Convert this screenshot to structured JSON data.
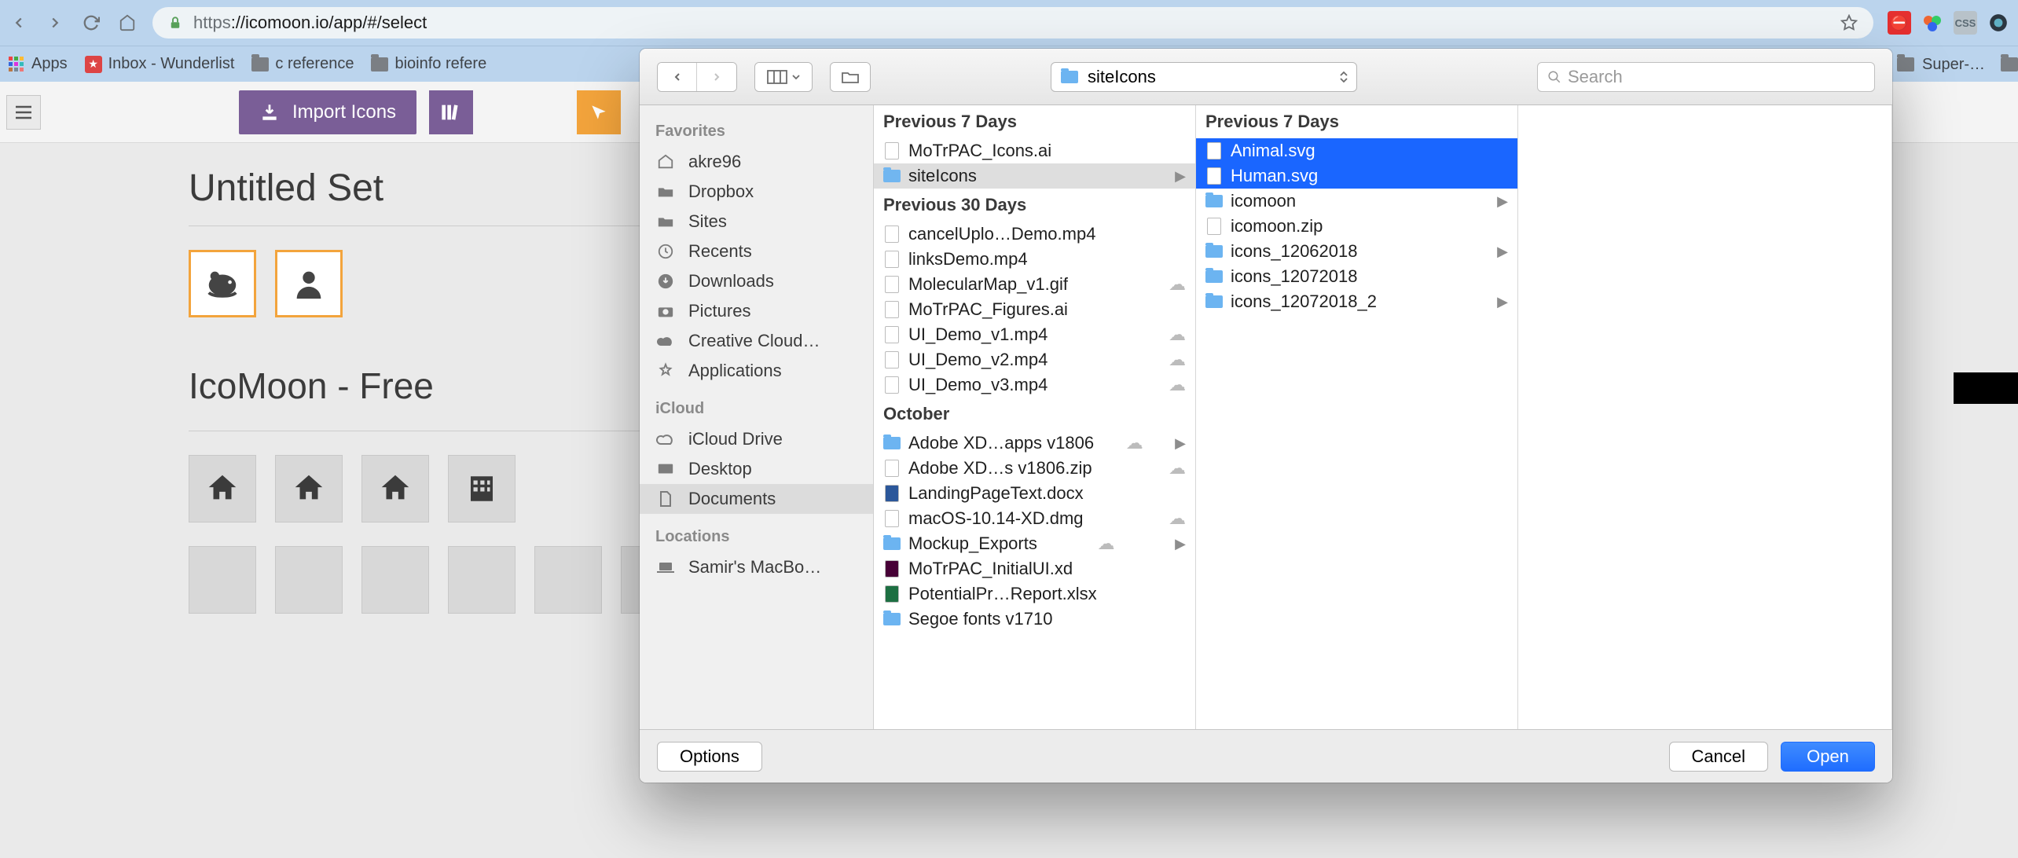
{
  "browser": {
    "url_proto": "https",
    "url_rest": "://icomoon.io/app/#/select",
    "bookmarks_label": "Apps",
    "bookmarks": [
      "Inbox - Wunderlist",
      "c reference",
      "bioinfo refere"
    ],
    "truncated_bookmark": "Super-…",
    "extensions": [
      "ABP",
      "color",
      "CSS",
      "eye"
    ]
  },
  "page": {
    "import_label": "Import Icons",
    "set_title": "Untitled Set",
    "free_title": "IcoMoon - Free"
  },
  "dialog": {
    "path_dropdown": "siteIcons",
    "search_placeholder": "Search",
    "options_label": "Options",
    "cancel_label": "Cancel",
    "open_label": "Open",
    "sidebar": {
      "favorites_label": "Favorites",
      "icloud_label": "iCloud",
      "locations_label": "Locations",
      "favorites": [
        "akre96",
        "Dropbox",
        "Sites",
        "Recents",
        "Downloads",
        "Pictures",
        "Creative Cloud…",
        "Applications"
      ],
      "icloud": [
        "iCloud Drive",
        "Desktop",
        "Documents"
      ],
      "locations": [
        "Samir's MacBo…"
      ]
    },
    "col1": {
      "h1": "Previous 7 Days",
      "g1": [
        "MoTrPAC_Icons.ai",
        "siteIcons"
      ],
      "h2": "Previous 30 Days",
      "g2": [
        "cancelUplo…Demo.mp4",
        "linksDemo.mp4",
        "MolecularMap_v1.gif",
        "MoTrPAC_Figures.ai",
        "UI_Demo_v1.mp4",
        "UI_Demo_v2.mp4",
        "UI_Demo_v3.mp4"
      ],
      "h3": "October",
      "g3": [
        "Adobe XD…apps v1806",
        "Adobe XD…s v1806.zip",
        "LandingPageText.docx",
        "macOS-10.14-XD.dmg",
        "Mockup_Exports",
        "MoTrPAC_InitialUI.xd",
        "PotentialPr…Report.xlsx",
        "Segoe fonts v1710"
      ]
    },
    "col2": {
      "h1": "Previous 7 Days",
      "items": [
        "Animal.svg",
        "Human.svg",
        "icomoon",
        "icomoon.zip",
        "icons_12062018",
        "icons_12072018",
        "icons_12072018_2"
      ]
    }
  }
}
